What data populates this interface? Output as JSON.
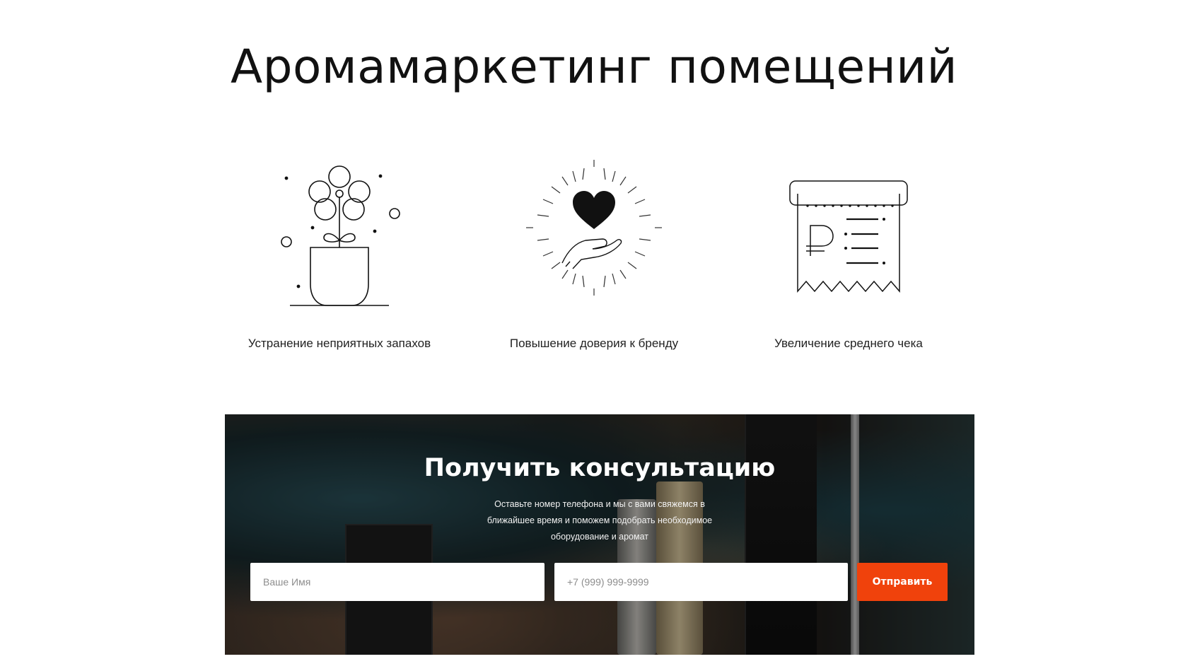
{
  "hero": {
    "title": "Аромамаркетинг помещений"
  },
  "features": [
    {
      "icon": "flower-pot-icon",
      "label": "Устранение неприятных запахов"
    },
    {
      "icon": "heart-hand-icon",
      "label": "Повышение доверия к бренду"
    },
    {
      "icon": "receipt-ruble-icon",
      "label": "Увеличение среднего чека"
    }
  ],
  "consultation": {
    "title": "Получить консультацию",
    "text": "Оставьте номер телефона и мы с вами свяжемся в ближайшее время и поможем подобрать необходимое оборудование и аромат",
    "name_placeholder": "Ваше Имя",
    "phone_placeholder": "+7 (999) 999-9999",
    "submit_label": "Отправить"
  },
  "colors": {
    "accent": "#f0420c",
    "text": "#111111",
    "background": "#ffffff"
  }
}
